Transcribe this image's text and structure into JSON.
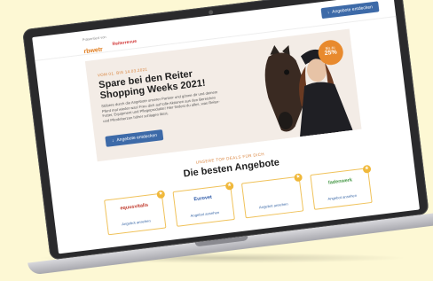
{
  "header": {
    "presented_by": "Präsentiert von",
    "brand1": "rbwetr",
    "brand2": "Reiterrevue",
    "cta_label": "Angebote entdecken"
  },
  "hero": {
    "date_line": "VOM 01. BIS 14.03.2021",
    "title": "Spare bei den Reiter Shopping Weeks 2021!",
    "description": "Stöbere durch die Angebote unserer Partner und gönne dir und deinem Pferd mal wieder was! Freu dich auf tolle Aktionen aus den Bereichen Futter, Equipment und Pflegeprodukte! Hier findest du alles, was Reiter- und Pferdeherzen höher schlagen lässt.",
    "cta_label": "Angebote entdecken",
    "badge_top": "Bis zu",
    "badge_value": "25%"
  },
  "deals": {
    "kicker": "UNSERE TOP DEALS FÜR DICH",
    "heading": "Die besten Angebote",
    "cards": [
      {
        "logo": "equusvitalis",
        "logo_color": "#c0392b",
        "link": "Angebot ansehen"
      },
      {
        "logo": "Eurovet",
        "logo_color": "#2e5aa8",
        "link": "Angebot ansehen"
      },
      {
        "logo": "",
        "logo_color": "#555555",
        "link": "Angebot ansehen"
      },
      {
        "logo": "fadenwerk",
        "logo_color": "#4a9a4a",
        "link": "Angebot ansehen"
      }
    ]
  }
}
